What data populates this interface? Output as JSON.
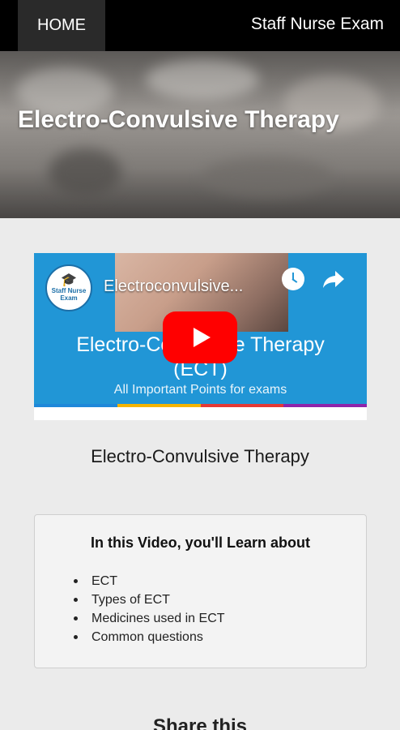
{
  "nav": {
    "home_label": "HOME",
    "brand": "Staff Nurse Exam"
  },
  "hero": {
    "title": "Electro-Convulsive Therapy"
  },
  "video": {
    "title": "Electroconvulsive...",
    "channel_logo_text": "Staff Nurse Exam",
    "big_text_line1": "Electro-Convulsive Therapy",
    "big_text_line2": "(ECT)",
    "subtitle": "All Important Points for exams",
    "strip_colors": [
      "#1e88d9",
      "#f4b400",
      "#e53935",
      "#8e24aa"
    ],
    "play_color": "#ff0000",
    "background_color": "#2196d6"
  },
  "caption": "Electro-Convulsive Therapy",
  "card": {
    "title": "In this Video, you'll Learn about",
    "items": [
      "ECT",
      "Types of ECT",
      "Medicines used in ECT",
      "Common questions"
    ]
  },
  "share_heading": "Share this"
}
